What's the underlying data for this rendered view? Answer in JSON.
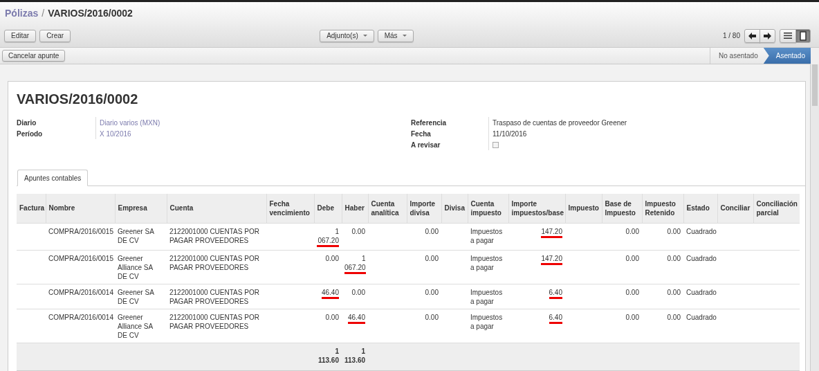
{
  "breadcrumb": {
    "parent": "Pólizas",
    "separator": "/",
    "current": "VARIOS/2016/0002"
  },
  "toolbar": {
    "buttons": [
      "Editar",
      "Crear"
    ],
    "menus": [
      "Adjunto(s)",
      "Más"
    ],
    "pager": "1 / 80",
    "views": [
      {
        "kind": "list",
        "selected": false
      },
      {
        "kind": "form",
        "selected": true
      }
    ]
  },
  "actions": [
    "Cancelar apunte"
  ],
  "statusbar": [
    {
      "label": "No asentado",
      "selected": false
    },
    {
      "label": "Asentado",
      "selected": true
    }
  ],
  "sheet": {
    "title": "VARIOS/2016/0002",
    "left_fields": [
      {
        "label": "Diario",
        "value": "Diario varios (MXN)",
        "kind": "link"
      },
      {
        "label": "Período",
        "value": "X 10/2016",
        "kind": "link"
      }
    ],
    "right_fields": [
      {
        "label": "Referencia",
        "value": "Traspaso de cuentas de proveedor Greener",
        "kind": "text"
      },
      {
        "label": "Fecha",
        "value": "11/10/2016",
        "kind": "text"
      },
      {
        "label": "A revisar",
        "kind": "checkbox",
        "checked": false
      }
    ],
    "tabs": [
      {
        "label": "Apuntes contables",
        "selected": true
      }
    ],
    "table": {
      "columns": [
        "Factura",
        "Nombre",
        "Empresa",
        "Cuenta",
        "Fecha vencimiento",
        "Debe",
        "Haber",
        "Cuenta analítica",
        "Importe divisa",
        "Divisa",
        "Cuenta impuesto",
        "Importe impuestos/base",
        "Impuesto",
        "Base de Impuesto",
        "Impuesto Retenido",
        "Estado",
        "Conciliar",
        "Conciliación parcial"
      ],
      "rows": [
        {
          "cells": [
            null,
            {
              "text": "COMPRA/2016/0015",
              "underlined": false
            },
            {
              "text": "Greener SA DE CV",
              "underlined": false
            },
            {
              "text": "2122001000 CUENTAS POR PAGAR PROVEEDORES",
              "underlined": false
            },
            null,
            {
              "text": "1 067.20",
              "underlined": true
            },
            {
              "text": "0.00",
              "underlined": false
            },
            null,
            {
              "text": "0.00",
              "underlined": false
            },
            null,
            {
              "text": "Impuestos a pagar",
              "underlined": false
            },
            {
              "text": "147.20",
              "underlined": true
            },
            null,
            {
              "text": "0.00",
              "underlined": false
            },
            {
              "text": "0.00",
              "underlined": false
            },
            {
              "text": "Cuadrado",
              "underlined": false
            },
            null,
            null
          ]
        },
        {
          "cells": [
            null,
            {
              "text": "COMPRA/2016/0015",
              "underlined": false
            },
            {
              "text": "Greener Alliance SA DE CV",
              "underlined": false
            },
            {
              "text": "2122001000 CUENTAS POR PAGAR PROVEEDORES",
              "underlined": false
            },
            null,
            {
              "text": "0.00",
              "underlined": false
            },
            {
              "text": "1 067.20",
              "underlined": true
            },
            null,
            {
              "text": "0.00",
              "underlined": false
            },
            null,
            {
              "text": "Impuestos a pagar",
              "underlined": false
            },
            {
              "text": "147.20",
              "underlined": true
            },
            null,
            {
              "text": "0.00",
              "underlined": false
            },
            {
              "text": "0.00",
              "underlined": false
            },
            {
              "text": "Cuadrado",
              "underlined": false
            },
            null,
            null
          ]
        },
        {
          "cells": [
            null,
            {
              "text": "COMPRA/2016/0014",
              "underlined": false
            },
            {
              "text": "Greener SA DE CV",
              "underlined": false
            },
            {
              "text": "2122001000 CUENTAS POR PAGAR PROVEEDORES",
              "underlined": false
            },
            null,
            {
              "text": "46.40",
              "underlined": true
            },
            {
              "text": "0.00",
              "underlined": false
            },
            null,
            {
              "text": "0.00",
              "underlined": false
            },
            null,
            {
              "text": "Impuestos a pagar",
              "underlined": false
            },
            {
              "text": "6.40",
              "underlined": true
            },
            null,
            {
              "text": "0.00",
              "underlined": false
            },
            {
              "text": "0.00",
              "underlined": false
            },
            {
              "text": "Cuadrado",
              "underlined": false
            },
            null,
            null
          ]
        },
        {
          "cells": [
            null,
            {
              "text": "COMPRA/2016/0014",
              "underlined": false
            },
            {
              "text": "Greener Alliance SA DE CV",
              "underlined": false
            },
            {
              "text": "2122001000 CUENTAS POR PAGAR PROVEEDORES",
              "underlined": false
            },
            null,
            {
              "text": "0.00",
              "underlined": false
            },
            {
              "text": "46.40",
              "underlined": true
            },
            null,
            {
              "text": "0.00",
              "underlined": false
            },
            null,
            {
              "text": "Impuestos a pagar",
              "underlined": false
            },
            {
              "text": "6.40",
              "underlined": true
            },
            null,
            {
              "text": "0.00",
              "underlined": false
            },
            {
              "text": "0.00",
              "underlined": false
            },
            {
              "text": "Cuadrado",
              "underlined": false
            },
            null,
            null
          ]
        }
      ],
      "totals": {
        "debe": "1 113.60",
        "haber": "1 113.60"
      }
    }
  }
}
